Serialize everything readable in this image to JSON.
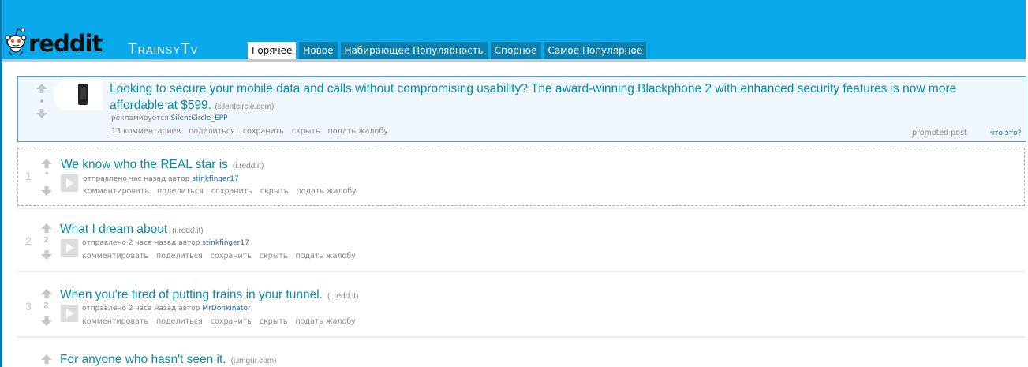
{
  "header": {
    "logo_text": "reddit",
    "subreddit": "TrainsyTv",
    "tabs": [
      {
        "label": "Горячее",
        "selected": true
      },
      {
        "label": "Новое",
        "selected": false
      },
      {
        "label": "Набирающее Популярность",
        "selected": false
      },
      {
        "label": "Спорное",
        "selected": false
      },
      {
        "label": "Самое Популярное",
        "selected": false
      }
    ]
  },
  "promoted": {
    "title": "Looking to secure your mobile data and calls without compromising usability? The award-winning Blackphone 2 with enhanced security features is now more affordable at $599.",
    "domain": "(silentcircle.com)",
    "by_prefix": "рекламируется",
    "user": "SilentCircle_EPP",
    "actions": [
      "13 комментариев",
      "поделиться",
      "сохранить",
      "скрыть",
      "подать жалобу"
    ],
    "label": "promoted post",
    "whats_this": "что это?",
    "thumbnail_icon": "phone-icon"
  },
  "posts": [
    {
      "rank": "1",
      "score": "•",
      "title": "We know who the REAL star is",
      "domain": "(i.redd.it)",
      "tagline_prefix": "отправлено час назад автор",
      "user": "stinkfinger17",
      "actions": [
        "комментировать",
        "поделиться",
        "сохранить",
        "скрыть",
        "подать жалобу"
      ]
    },
    {
      "rank": "2",
      "score": "2",
      "title": "What I dream about",
      "domain": "(i.redd.it)",
      "tagline_prefix": "отправлено 2 часа назад автор",
      "user": "stinkfinger17",
      "actions": [
        "комментировать",
        "поделиться",
        "сохранить",
        "скрыть",
        "подать жалобу"
      ]
    },
    {
      "rank": "3",
      "score": "2",
      "title": "When you're tired of putting trains in your tunnel.",
      "domain": "(i.redd.it)",
      "tagline_prefix": "отправлено 2 часа назад автор",
      "user": "MrDonkinator",
      "actions": [
        "комментировать",
        "поделиться",
        "сохранить",
        "скрыть",
        "подать жалобу"
      ]
    },
    {
      "title": "For anyone who hasn't seen it.",
      "domain": "(i.imgur.com)"
    }
  ],
  "colors": {
    "header": "#0aa9ec",
    "title_link": "#0a8ba6",
    "tab": "#0e7fad"
  }
}
